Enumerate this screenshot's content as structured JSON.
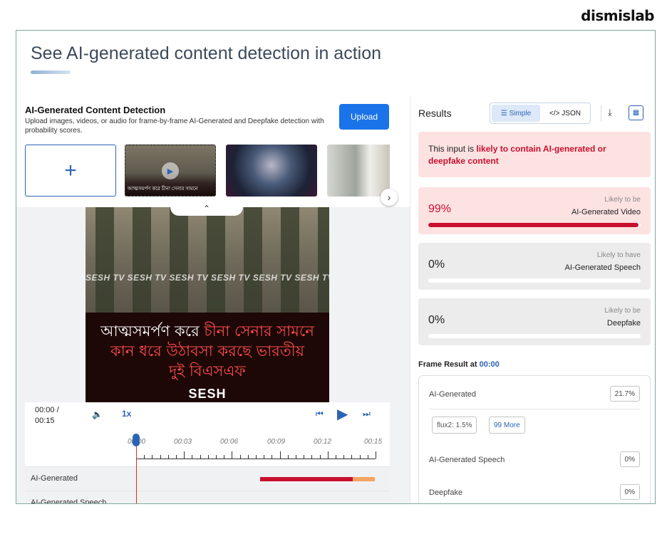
{
  "brand": "dismislab",
  "headline": "See AI-generated content detection in action",
  "detection": {
    "title": "AI-Generated Content Detection",
    "description": "Upload images, videos, or audio for frame-by-frame AI-Generated and Deepfake detection with probability scores.",
    "upload_label": "Upload",
    "add_symbol": "+",
    "thumb_caption": "আত্মসমর্পণ করে চীনা সেনার সামনে"
  },
  "video": {
    "watermark": "SESH TV SESH TV SESH TV SESH TV SESH TV SESH TV",
    "caption_line1_a": "আত্মসমর্পণ করে ",
    "caption_line1_b": "চীনা সেনার সামনে",
    "caption_line2": "কান ধরে উঠাবসা করছে ভারতীয়",
    "caption_line3": "দুই বিএসএফ",
    "logo": "SESH"
  },
  "player": {
    "current_time": "00:00 /",
    "duration": "00:15",
    "speed": "1x",
    "ticks": [
      "00:00",
      "00:03",
      "00:06",
      "00:09",
      "00:12",
      "00:15"
    ],
    "tracks": [
      "AI-Generated",
      "AI-Generated Speech"
    ]
  },
  "results": {
    "title": "Results",
    "toggle_simple": "Simple",
    "toggle_json": "</> JSON",
    "verdict_prefix": "This input is ",
    "verdict_emphasis": "likely to contain AI-generated or deepfake content",
    "cards": [
      {
        "pct": "99%",
        "value": 0.99,
        "likely": "Likely to be",
        "label": "AI-Generated Video"
      },
      {
        "pct": "0%",
        "value": 0.0,
        "likely": "Likely to have",
        "label": "AI-Generated Speech"
      },
      {
        "pct": "0%",
        "value": 0.0,
        "likely": "Likely to be",
        "label": "Deepfake"
      }
    ],
    "frame_result_label": "Frame Result at",
    "frame_result_time": "00:00",
    "frame_rows": [
      {
        "label": "AI-Generated",
        "value": "21.7%"
      },
      {
        "label": "AI-Generated Speech",
        "value": "0%"
      },
      {
        "label": "Deepfake",
        "value": "0%"
      }
    ],
    "chips": [
      "flux2: 1.5%",
      "99 More"
    ]
  },
  "colors": {
    "accent": "#1a73e8",
    "alert_red": "#c8102e",
    "alert_bg": "#fde2e2",
    "orange": "#f4a460"
  }
}
